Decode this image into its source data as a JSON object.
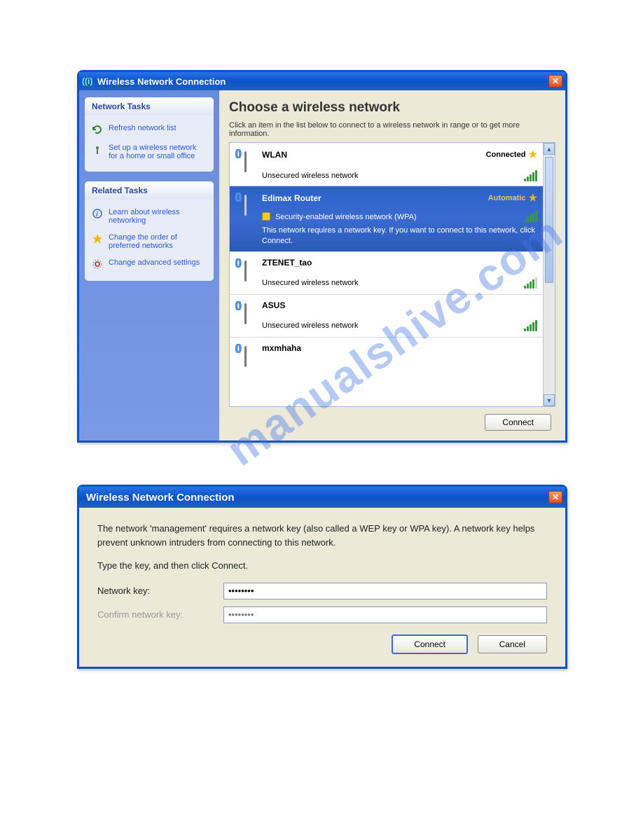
{
  "win1": {
    "title": "Wireless Network Connection",
    "sidebar": {
      "network_tasks_h": "Network Tasks",
      "tasks": [
        {
          "label": "Refresh network list"
        },
        {
          "label": "Set up a wireless network for a home or small office"
        }
      ],
      "related_tasks_h": "Related Tasks",
      "related": [
        {
          "label": "Learn about wireless networking"
        },
        {
          "label": "Change the order of preferred networks"
        },
        {
          "label": "Change advanced settings"
        }
      ]
    },
    "main_title": "Choose a wireless network",
    "main_sub": "Click an item in the list below to connect to a wireless network in range or to get more information.",
    "networks": [
      {
        "name": "WLAN",
        "status": "Connected",
        "star": true,
        "desc": "Unsecured wireless network",
        "signal": 5,
        "selected": false
      },
      {
        "name": "Edimax Router",
        "status": "Automatic",
        "star": true,
        "sec": "Security-enabled wireless network (WPA)",
        "msg": "This network requires a network key. If you want to connect to this network, click Connect.",
        "signal": 5,
        "selected": true
      },
      {
        "name": "ZTENET_tao",
        "desc": "Unsecured wireless network",
        "signal": 4,
        "selected": false
      },
      {
        "name": "ASUS",
        "desc": "Unsecured wireless network",
        "signal": 5,
        "selected": false
      },
      {
        "name": "mxmhaha",
        "desc": "",
        "signal": 0,
        "selected": false
      }
    ],
    "connect_btn": "Connect"
  },
  "win2": {
    "title": "Wireless Network Connection",
    "msg1": "The network 'management' requires a network key (also called a WEP key or WPA key). A network key helps prevent unknown intruders from connecting to this network.",
    "msg2": "Type the key, and then click Connect.",
    "field1": "Network key:",
    "field2": "Confirm network key:",
    "val1": "••••••••",
    "placeholder2": "••••••••",
    "connect": "Connect",
    "cancel": "Cancel"
  }
}
